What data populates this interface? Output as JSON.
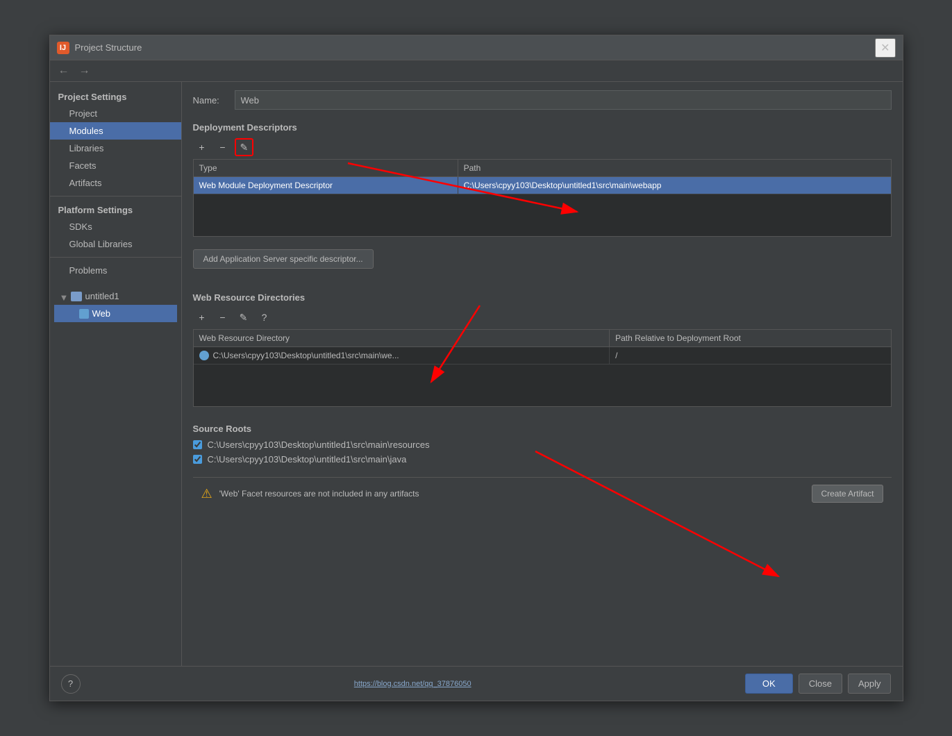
{
  "dialog": {
    "title": "Project Structure",
    "icon_label": "IJ",
    "close_button": "✕"
  },
  "nav": {
    "back_button": "←",
    "forward_button": "→"
  },
  "sidebar": {
    "project_settings_label": "Project Settings",
    "items": [
      {
        "id": "project",
        "label": "Project",
        "active": false
      },
      {
        "id": "modules",
        "label": "Modules",
        "active": true
      },
      {
        "id": "libraries",
        "label": "Libraries",
        "active": false
      },
      {
        "id": "facets",
        "label": "Facets",
        "active": false
      },
      {
        "id": "artifacts",
        "label": "Artifacts",
        "active": false
      }
    ],
    "platform_settings_label": "Platform Settings",
    "platform_items": [
      {
        "id": "sdks",
        "label": "SDKs",
        "active": false
      },
      {
        "id": "global-libraries",
        "label": "Global Libraries",
        "active": false
      }
    ],
    "problems_label": "Problems",
    "tree": {
      "parent": "untitled1",
      "child": "Web"
    }
  },
  "right_panel": {
    "name_label": "Name:",
    "name_value": "Web",
    "deployment_descriptors_title": "Deployment Descriptors",
    "toolbar": {
      "add_btn": "+",
      "remove_btn": "−",
      "edit_btn": "✎"
    },
    "table_headers": [
      "Type",
      "Path"
    ],
    "table_rows": [
      {
        "type": "Web Module Deployment Descriptor",
        "path": "C:\\Users\\cpyy103\\Desktop\\untitled1\\src\\main\\webapp",
        "selected": true
      }
    ],
    "add_server_btn_label": "Add Application Server specific descriptor...",
    "web_resource_title": "Web Resource Directories",
    "web_resource_toolbar": {
      "add_btn": "+",
      "remove_btn": "−",
      "edit_btn": "✎",
      "help_btn": "?"
    },
    "web_resource_headers": [
      "Web Resource Directory",
      "Path Relative to Deployment Root"
    ],
    "web_resource_rows": [
      {
        "dir": "C:\\Users\\cpyy103\\Desktop\\untitled1\\src\\main\\we...",
        "rel_path": "/"
      }
    ],
    "source_roots_title": "Source Roots",
    "source_roots": [
      {
        "path": "C:\\Users\\cpyy103\\Desktop\\untitled1\\src\\main\\resources",
        "checked": true
      },
      {
        "path": "C:\\Users\\cpyy103\\Desktop\\untitled1\\src\\main\\java",
        "checked": true
      }
    ],
    "warning_text": "'Web' Facet resources are not included in any artifacts",
    "create_artifact_btn": "Create Artifact"
  },
  "bottom_bar": {
    "help_link": "https://blog.csdn.net/qq_37876050",
    "ok_label": "OK",
    "close_label": "Close",
    "apply_label": "Apply"
  }
}
